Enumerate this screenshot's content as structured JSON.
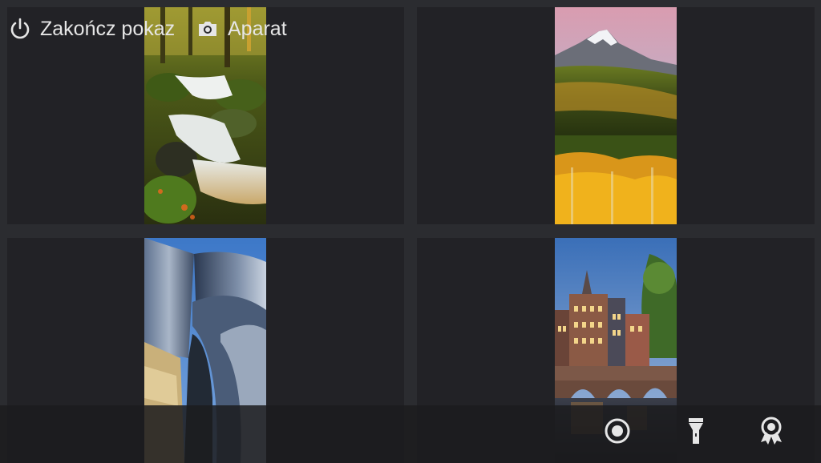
{
  "wallpapers": [
    {
      "subject": "forest-waterfall"
    },
    {
      "subject": "mountain-autumn"
    },
    {
      "subject": "curved-metal-architecture"
    },
    {
      "subject": "canal-houses-bridge"
    }
  ],
  "bottom_bar": {
    "end_show_label": "Zakończ pokaz",
    "camera_label": "Aparat",
    "icons": [
      "power-icon",
      "camera-icon",
      "record-icon",
      "flashlight-icon",
      "award-icon"
    ]
  },
  "colors": {
    "background": "#2b2c30",
    "tile": "#222226",
    "text": "#e6e6e6"
  }
}
